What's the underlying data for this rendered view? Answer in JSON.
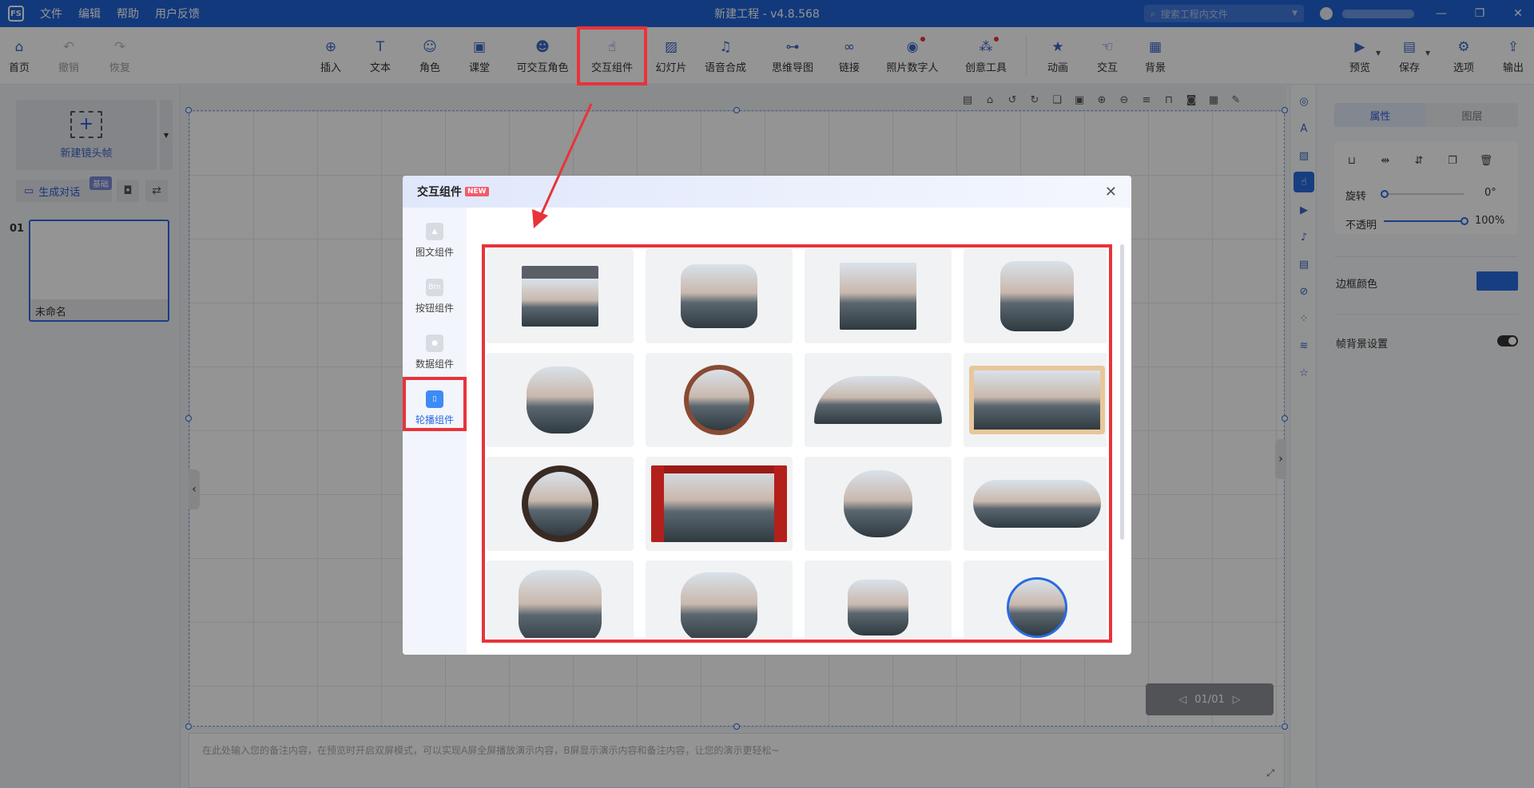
{
  "titlebar": {
    "logo": "FS",
    "menus": [
      "文件",
      "编辑",
      "帮助",
      "用户反馈"
    ],
    "title": "新建工程 - v4.8.568",
    "search_placeholder": "搜索工程内文件"
  },
  "toolbar": {
    "left": [
      {
        "label": "首页",
        "icon": "home-icon",
        "glyph": "⌂"
      },
      {
        "label": "撤销",
        "icon": "undo-icon",
        "glyph": "↶",
        "disabled": true
      },
      {
        "label": "恢复",
        "icon": "redo-icon",
        "glyph": "↷",
        "disabled": true
      }
    ],
    "center": [
      {
        "label": "插入",
        "icon": "insert-icon",
        "glyph": "⊕"
      },
      {
        "label": "文本",
        "icon": "text-icon",
        "glyph": "T"
      },
      {
        "label": "角色",
        "icon": "character-icon",
        "glyph": "☺"
      },
      {
        "label": "课堂",
        "icon": "classroom-icon",
        "glyph": "▣"
      },
      {
        "label": "可交互角色",
        "icon": "interactive-character-icon",
        "glyph": "☻"
      },
      {
        "label": "交互组件",
        "icon": "interactive-component-icon",
        "glyph": "☝"
      },
      {
        "label": "幻灯片",
        "icon": "slideshow-icon",
        "glyph": "▨"
      },
      {
        "label": "语音合成",
        "icon": "speech-synthesis-icon",
        "glyph": "♫"
      },
      {
        "label": "思维导图",
        "icon": "mindmap-icon",
        "glyph": "⊶"
      },
      {
        "label": "链接",
        "icon": "link-icon",
        "glyph": "∞"
      },
      {
        "label": "照片数字人",
        "icon": "photo-avatar-icon",
        "glyph": "◉"
      },
      {
        "label": "创意工具",
        "icon": "creative-tools-icon",
        "glyph": "⁂"
      },
      {
        "label": "动画",
        "icon": "animation-icon",
        "glyph": "★"
      },
      {
        "label": "交互",
        "icon": "interaction-icon",
        "glyph": "☜"
      },
      {
        "label": "背景",
        "icon": "background-icon",
        "glyph": "▦"
      }
    ],
    "right": [
      {
        "label": "预览",
        "icon": "preview-icon",
        "glyph": "▶"
      },
      {
        "label": "保存",
        "icon": "save-icon",
        "glyph": "▤"
      },
      {
        "label": "选项",
        "icon": "options-icon",
        "glyph": "⚙"
      },
      {
        "label": "输出",
        "icon": "export-icon",
        "glyph": "⇪"
      }
    ]
  },
  "left_panel": {
    "new_frame_label": "新建镜头帧",
    "generate_dialog_label": "生成对话",
    "generate_badge": "基础",
    "frame_number": "01",
    "frame_name": "未命名"
  },
  "canvas": {
    "pager": "01/01",
    "notes_placeholder": "在此处输入您的备注内容，在预览时开启双屏模式，可以实现A屏全屏播放演示内容，B屏显示演示内容和备注内容，让您的演示更轻松~"
  },
  "right_panel": {
    "tabs": [
      "属性",
      "图层"
    ],
    "rotate_label": "旋转",
    "rotate_value": "0°",
    "opacity_label": "不透明",
    "opacity_value": "100%",
    "opacity_fraction": 1.0,
    "border_color_label": "边框颜色",
    "border_color": "#2a6be0",
    "frame_bg_label": "帧背景设置"
  },
  "modal": {
    "title": "交互组件",
    "new_badge": "NEW",
    "nav": [
      {
        "label": "图文组件",
        "icon": "image-text-component-icon",
        "glyph": "▲"
      },
      {
        "label": "按钮组件",
        "icon": "button-component-icon",
        "glyph": "Btn"
      },
      {
        "label": "数据组件",
        "icon": "data-component-icon",
        "glyph": "●"
      },
      {
        "label": "轮播组件",
        "icon": "carousel-component-icon",
        "glyph": "▯",
        "active": true
      }
    ],
    "components": [
      "projector-carousel",
      "rounded-bars-carousel",
      "tilted-strips-carousel",
      "hexagon-carousel",
      "clover-carousel",
      "chinese-window-carousel",
      "folding-fan-carousel",
      "scroll-painting-carousel",
      "vinyl-record-carousel",
      "theater-curtain-carousel",
      "cloud-blob-carousel",
      "lotus-carousel",
      "flower-star-carousel",
      "petal-cross-carousel",
      "rounded-square-carousel",
      "circle-frame-carousel"
    ]
  },
  "colors": {
    "brand_blue": "#1f62d6",
    "accent": "#2a6be0",
    "highlight_red": "#e8333a"
  }
}
